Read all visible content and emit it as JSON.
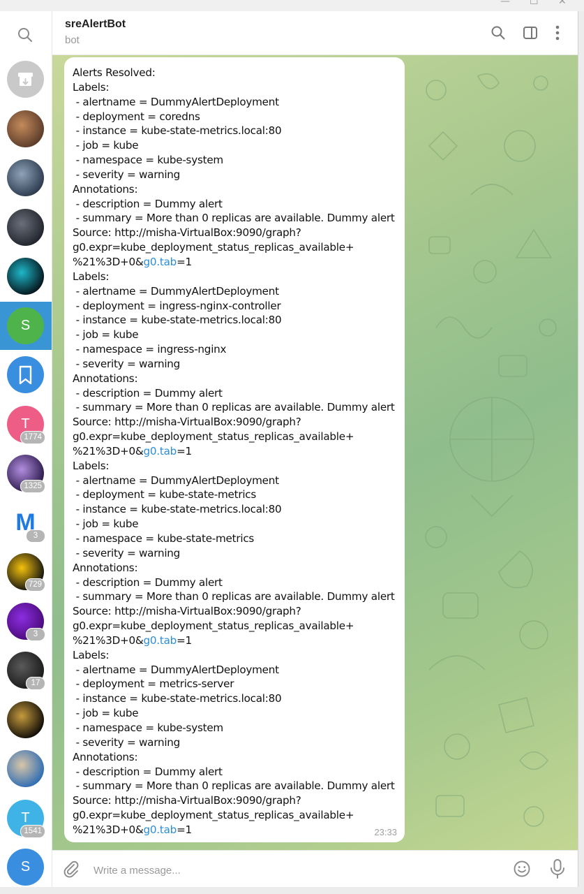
{
  "window": {
    "minimize": "—",
    "maximize": "☐",
    "close": "✕"
  },
  "header": {
    "title": "sreAlertBot",
    "subtitle": "bot"
  },
  "sidebar": {
    "chats": [
      {
        "kind": "archive"
      },
      {
        "kind": "photo",
        "colors": [
          "#5a3b2a",
          "#c48a5a"
        ]
      },
      {
        "kind": "photo",
        "colors": [
          "#2c3a4e",
          "#8ea3b8"
        ]
      },
      {
        "kind": "photo",
        "colors": [
          "#20232b",
          "#6a6f7a"
        ]
      },
      {
        "kind": "photo",
        "colors": [
          "#05141a",
          "#1fb7c9"
        ]
      },
      {
        "kind": "letter",
        "letter": "S",
        "color": "#4fb34c",
        "selected": true
      },
      {
        "kind": "saved",
        "color": "#3a8ee0"
      },
      {
        "kind": "letter",
        "letter": "T",
        "color": "#ee5d86",
        "badge": "1774"
      },
      {
        "kind": "photo",
        "colors": [
          "#2b1a4a",
          "#b28de0"
        ],
        "badge": "1325"
      },
      {
        "kind": "logo",
        "letter": "M",
        "badge": "3"
      },
      {
        "kind": "photo",
        "colors": [
          "#111111",
          "#f4c20d"
        ],
        "badge": "729"
      },
      {
        "kind": "photo",
        "colors": [
          "#4a0b7a",
          "#8c2de0"
        ],
        "badge": "3"
      },
      {
        "kind": "photo",
        "colors": [
          "#1a1a1a",
          "#5a5a5a"
        ],
        "badge": "17"
      },
      {
        "kind": "photo",
        "colors": [
          "#0f0c08",
          "#c69b3d"
        ]
      },
      {
        "kind": "photo",
        "colors": [
          "#2e6cb4",
          "#d8c6a8"
        ]
      },
      {
        "kind": "letter",
        "letter": "T",
        "color": "#3fb3e5",
        "badge": "1541"
      },
      {
        "kind": "letter",
        "letter": "S",
        "color": "#3a8ee0"
      }
    ]
  },
  "message": {
    "blocks": [
      {
        "text": "Alerts Resolved:\nLabels:\n - alertname = DummyAlertDeployment\n - deployment = coredns\n - instance = kube-state-metrics.local:80\n - job = kube\n - namespace = kube-system\n - severity = warning\nAnnotations:\n - description = Dummy alert\n - summary = More than 0 replicas are available. Dummy alert\nSource: http://misha-VirtualBox:9090/graph?\ng0.expr=kube_deployment_status_replicas_available+\n%21%3D+0&",
        "link": "g0.tab",
        "tail": "=1\n"
      },
      {
        "text": "Labels:\n - alertname = DummyAlertDeployment\n - deployment = ingress-nginx-controller\n - instance = kube-state-metrics.local:80\n - job = kube\n - namespace = ingress-nginx\n - severity = warning\nAnnotations:\n - description = Dummy alert\n - summary = More than 0 replicas are available. Dummy alert\nSource: http://misha-VirtualBox:9090/graph?\ng0.expr=kube_deployment_status_replicas_available+\n%21%3D+0&",
        "link": "g0.tab",
        "tail": "=1\n"
      },
      {
        "text": "Labels:\n - alertname = DummyAlertDeployment\n - deployment = kube-state-metrics\n - instance = kube-state-metrics.local:80\n - job = kube\n - namespace = kube-state-metrics\n - severity = warning\nAnnotations:\n - description = Dummy alert\n - summary = More than 0 replicas are available. Dummy alert\nSource: http://misha-VirtualBox:9090/graph?\ng0.expr=kube_deployment_status_replicas_available+\n%21%3D+0&",
        "link": "g0.tab",
        "tail": "=1\n"
      },
      {
        "text": "Labels:\n - alertname = DummyAlertDeployment\n - deployment = metrics-server\n - instance = kube-state-metrics.local:80\n - job = kube\n - namespace = kube-system\n - severity = warning\nAnnotations:\n - description = Dummy alert\n - summary = More than 0 replicas are available. Dummy alert\nSource: http://misha-VirtualBox:9090/graph?\ng0.expr=kube_deployment_status_replicas_available+\n%21%3D+0&",
        "link": "g0.tab",
        "tail": "=1"
      }
    ],
    "time": "23:33"
  },
  "composer": {
    "placeholder": "Write a message..."
  },
  "colors": {
    "accent": "#3a95d5",
    "link": "#2b8ed6",
    "selected_row": "#3a95d5"
  }
}
